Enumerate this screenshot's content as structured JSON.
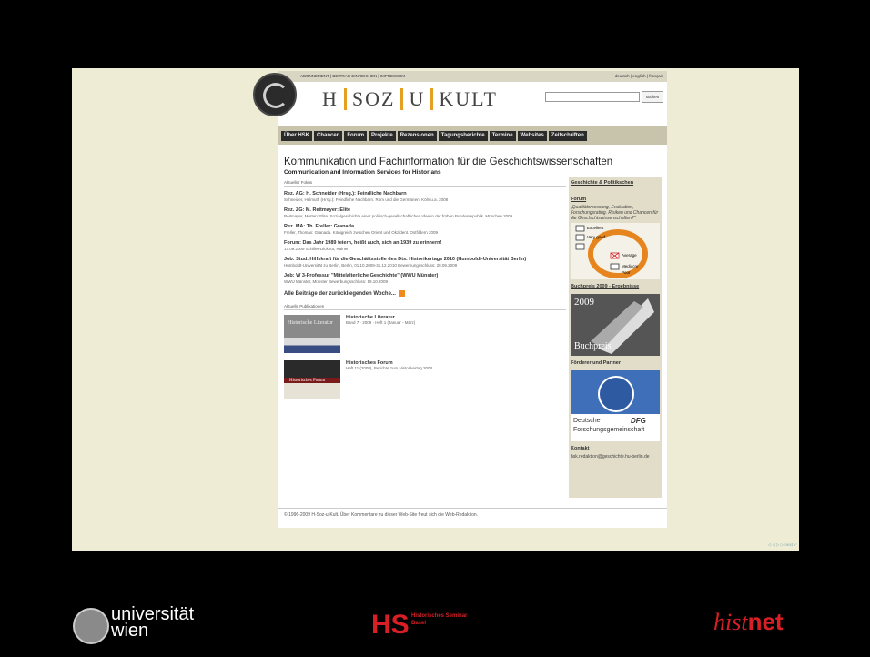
{
  "top_links": "ABONNEMENT | BEITRAG EINREICHEN | IMPRESSUM",
  "languages": "deutsch | english | français",
  "brand": {
    "h": "H",
    "soz": "SOZ",
    "u": "U",
    "kult": "KULT"
  },
  "search_button": "suchen",
  "nav": [
    "Über HSK",
    "Chancen",
    "Forum",
    "Projekte",
    "Rezensionen",
    "Tagungsberichte",
    "Termine",
    "Websites",
    "Zeitschriften"
  ],
  "heading": "Kommunikation und Fachinformation für die Geschichtswissenschaften",
  "subheading": "Communication and Information Services for Historians",
  "focus_label": "Aktueller Fokus",
  "items": [
    {
      "title": "Rez. AG: H. Schneider (Hrsg.): Feindliche Nachbarn",
      "desc": "Schneider, Helmuth (Hrsg.): Feindliche Nachbarn. Rom und die Germanen. Köln u.a. 2008"
    },
    {
      "title": "Rez. ZG: M. Reitmayer: Elite",
      "desc": "Reitmayer, Morten: Elite. Sozialgeschichte einer politisch-gesellschaftlichen Idee in der frühen Bundesrepublik. München 2009"
    },
    {
      "title": "Rez. MA: Th. Freller: Granada",
      "desc": "Freller, Thomas: Granada. Königreich zwischen Orient und Okzident. Ostfildern 2009"
    },
    {
      "title": "Forum: Das Jahr 1989 feiern, heißt auch, sich an 1939 zu erinnern!",
      "desc": "17.09.2009 Schiller-Dickhut, Rainer"
    },
    {
      "title": "Job: Stud. Hilfskraft für die Geschäftsstelle des Dts. Historikertags 2010 (Humboldt-Universität Berlin)",
      "desc": "Humboldt-Universität zu Berlin, Berlin, 01.10.2009-31.12.2010 Bewerbungsschluss: 28.09.2009"
    },
    {
      "title": "Job: W 3-Professur \"Mittelalterliche Geschichte\" (WWU Münster)",
      "desc": "WWU Münster, Münster Bewerbungsschluss: 19.10.2009"
    }
  ],
  "all_link": "Alle Beiträge der zurückliegenden Woche...",
  "pub_label": "Aktuelle Publikationen",
  "pubs": [
    {
      "title": "Historische Literatur",
      "desc": "Band 7 · 2009 · Heft 1 (Januar - März)",
      "cover": "Historische Literatur"
    },
    {
      "title": "Historisches Forum",
      "desc": "Heft 11 (2008), Berichte zum Historikertag 2008",
      "cover": "Historisches Forum"
    }
  ],
  "footer": "© 1996-2009 H-Soz-u-Kult. Über Kommentare zu dieser Web-Site freut sich die Web-Redaktion.",
  "sidebar": {
    "gp": "Geschichte & Politikschen",
    "forum": "Forum",
    "forum_text": "„Qualitätsmessung, Evaluation, Forschungsrating. Risiken und Chancen für die Geschichtswissenschaften?\"",
    "poll": [
      "Excellent",
      "Very good",
      "Average",
      "Mediocre",
      "Poor"
    ],
    "buchpreis": "Buchpreis 2009 - Ergebnisse",
    "buch_year": "2009",
    "buch_label": "Buchpreis",
    "foerderer": "Förderer und Partner",
    "dfg1": "Deutsche",
    "dfg2": "Forschungsgemeinschaft",
    "dfg": "DFG",
    "kontakt": "Kontakt",
    "email": "hsk.redaktion@geschichte.hu-berlin.de"
  },
  "corner": "◁ ◁ ▷ ▷  next ✓",
  "bottom": {
    "uni1": "universität",
    "uni2": "wien",
    "hs_main": "HS",
    "hs_text": "Historisches Seminar",
    "hs_sub": "Basel",
    "hist": "hist",
    "net": "net"
  }
}
